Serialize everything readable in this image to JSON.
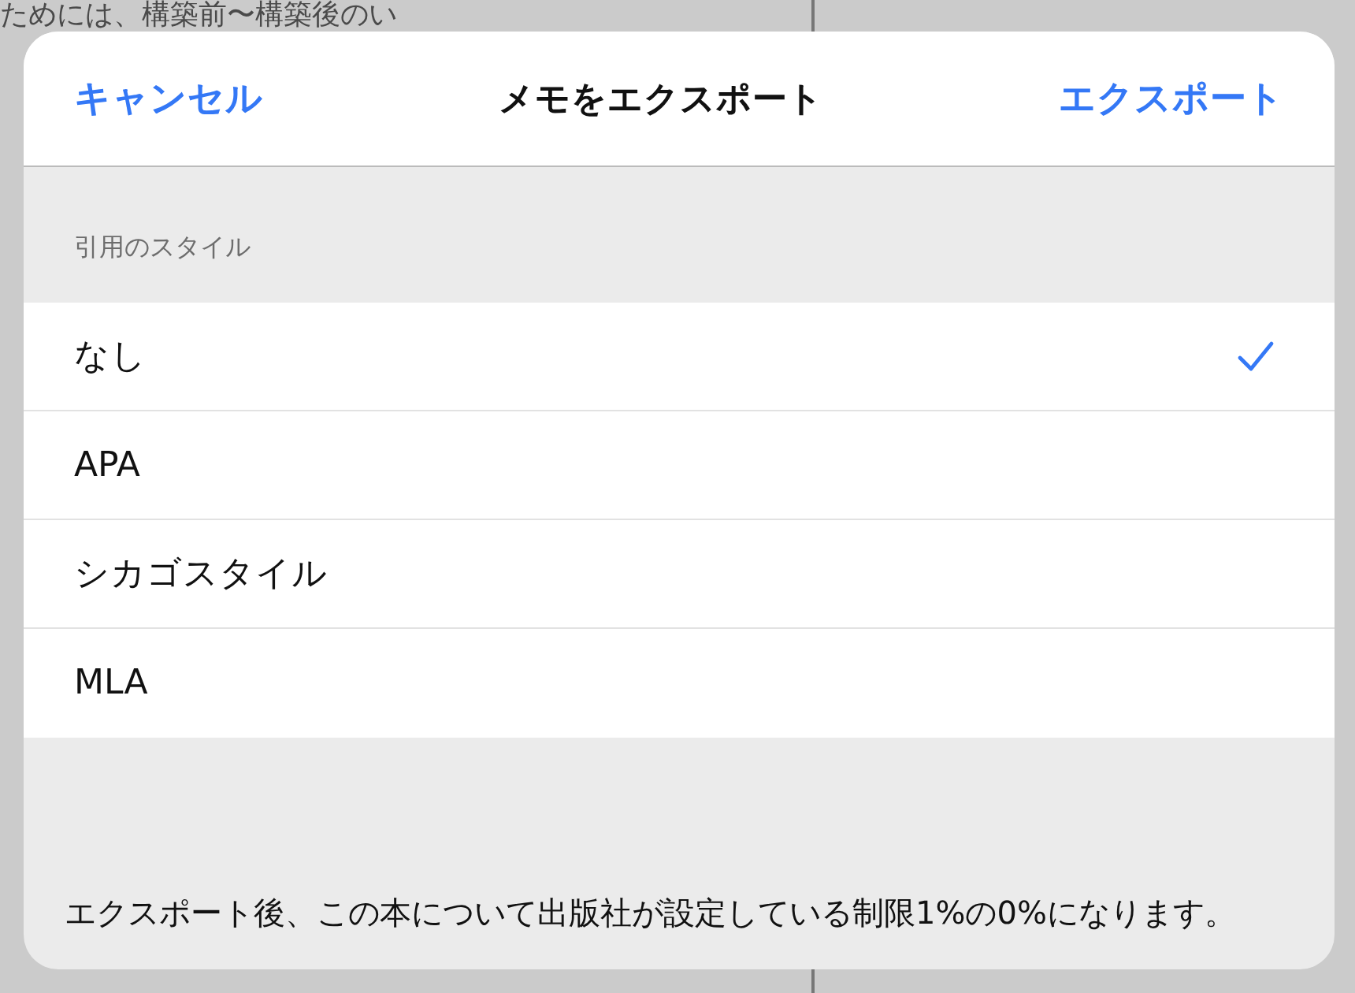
{
  "background_page": {
    "first_line": "ためには、構築前〜構築後のい"
  },
  "dialog": {
    "cancel": "キャンセル",
    "title": "メモをエクスポート",
    "export": "エクスポート",
    "section_header": "引用のスタイル",
    "options": [
      {
        "label": "なし",
        "selected": true
      },
      {
        "label": "APA",
        "selected": false
      },
      {
        "label": "シカゴスタイル",
        "selected": false
      },
      {
        "label": "MLA",
        "selected": false
      }
    ],
    "footer_note": "エクスポート後、この本について出版社が設定している制限1%の0%になります。"
  }
}
